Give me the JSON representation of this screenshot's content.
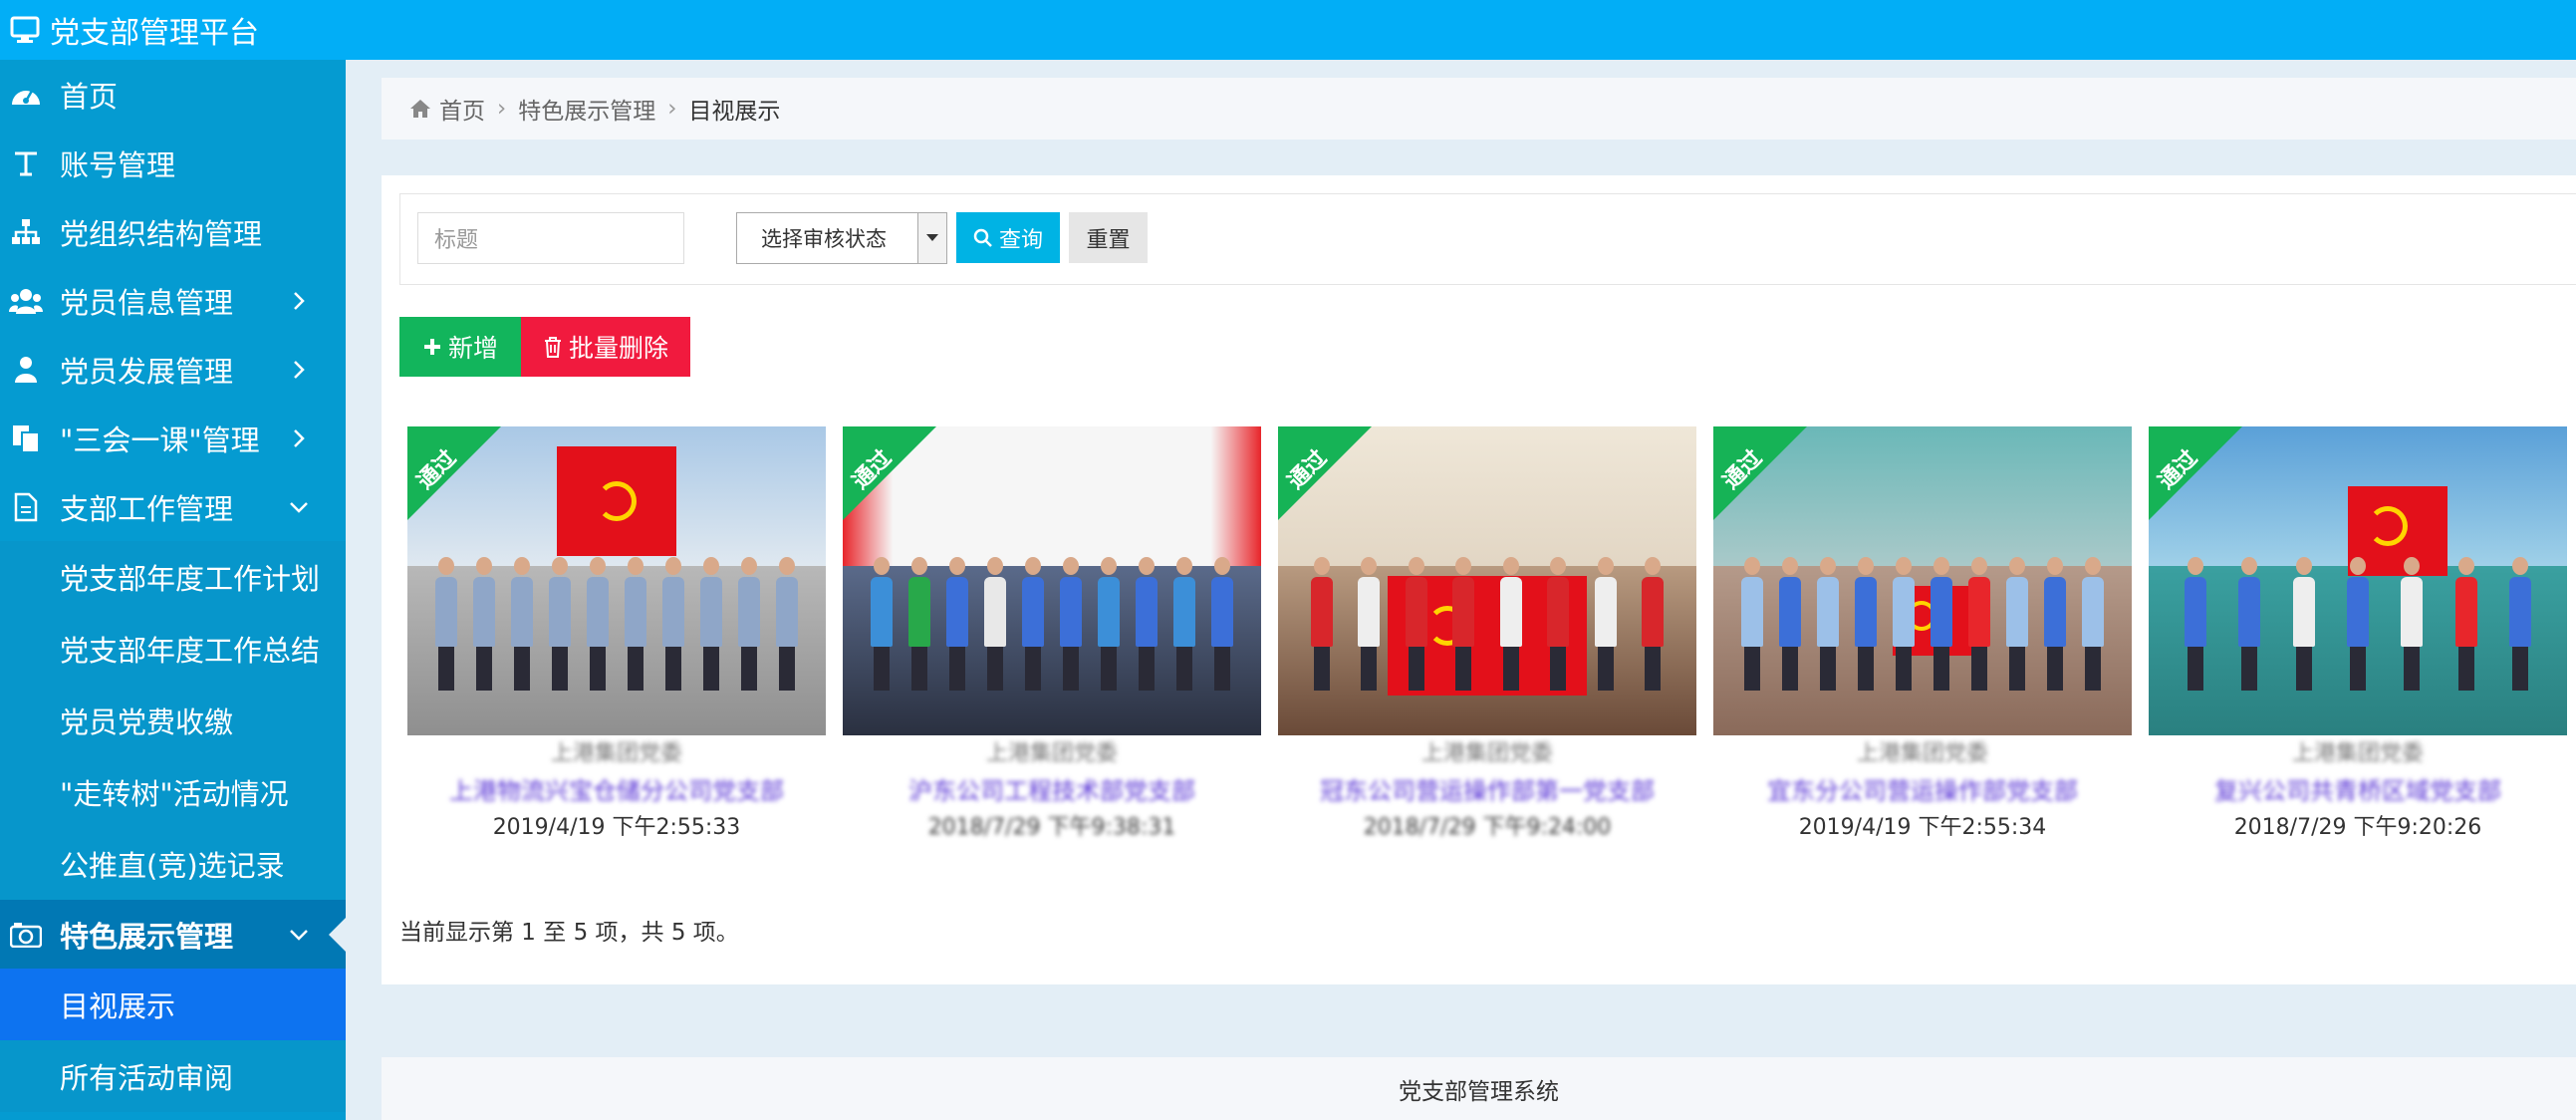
{
  "app": {
    "title": "党支部管理平台",
    "icon": "monitor-icon"
  },
  "sidebar": {
    "items": [
      {
        "label": "首页",
        "icon": "dashboard-icon",
        "arrow": ""
      },
      {
        "label": "账号管理",
        "icon": "text-icon",
        "arrow": ""
      },
      {
        "label": "党组织结构管理",
        "icon": "sitemap-icon",
        "arrow": ""
      },
      {
        "label": "党员信息管理",
        "icon": "users-icon",
        "arrow": "right"
      },
      {
        "label": "党员发展管理",
        "icon": "user-icon",
        "arrow": "right"
      },
      {
        "label": "\"三会一课\"管理",
        "icon": "copy-icon",
        "arrow": "right"
      },
      {
        "label": "支部工作管理",
        "icon": "file-icon",
        "arrow": "down"
      }
    ],
    "work_sub": [
      "党支部年度工作计划",
      "党支部年度工作总结",
      "党员党费收缴",
      "\"走转树\"活动情况",
      "公推直(竞)选记录"
    ],
    "feature": {
      "label": "特色展示管理",
      "icon": "camera-icon"
    },
    "feature_sub": [
      "目视展示",
      "所有活动审阅"
    ]
  },
  "breadcrumb": {
    "home": "首页",
    "parent": "特色展示管理",
    "current": "目视展示"
  },
  "search": {
    "title_placeholder": "标题",
    "status_select": "选择审核状态",
    "query_label": "查询",
    "reset_label": "重置"
  },
  "actions": {
    "add_label": "新增",
    "batch_delete_label": "批量删除"
  },
  "cards": [
    {
      "badge": "通过",
      "org": "上港集团党委",
      "branch": "上港物流兴宝仓储分公司党支部",
      "time": "2019/4/19 下午2:55:33"
    },
    {
      "badge": "通过",
      "org": "上港集团党委",
      "branch": "沪东公司工程技术部党支部",
      "time": "2018/7/29 下午9:38:31"
    },
    {
      "badge": "通过",
      "org": "上港集团党委",
      "branch": "冠东公司营运操作部第一党支部",
      "time": "2018/7/29 下午9:24:00"
    },
    {
      "badge": "通过",
      "org": "上港集团党委",
      "branch": "宜东分公司营运操作部党支部",
      "time": "2019/4/19 下午2:55:34"
    },
    {
      "badge": "通过",
      "org": "上港集团党委",
      "branch": "复兴公司共青桥区域党支部",
      "time": "2018/7/29 下午9:20:26"
    }
  ],
  "pagination_info": "当前显示第 1 至 5 项，共 5 项。",
  "footer": {
    "text": "党支部管理系统"
  },
  "colors": {
    "topbar": "#02aef6",
    "sidebar": "#059bd1",
    "active": "#0178b4",
    "current": "#0d73f0",
    "add": "#12b55c",
    "delete": "#f11a3e",
    "query": "#00b3e4"
  }
}
